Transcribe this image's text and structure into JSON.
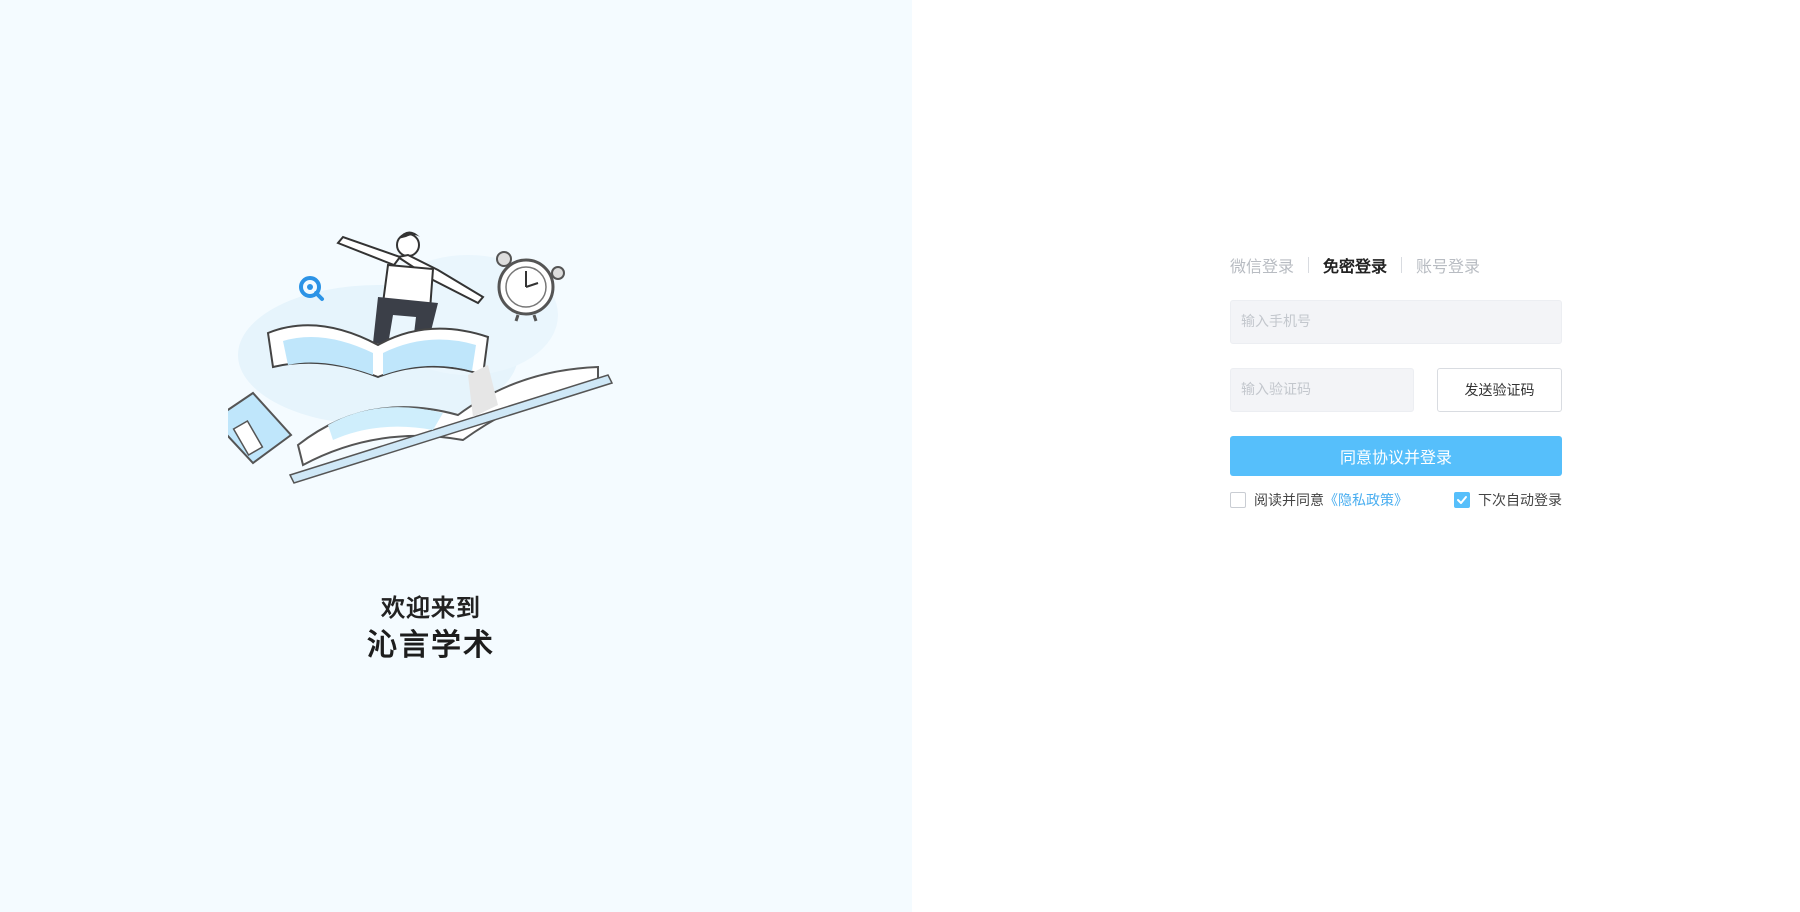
{
  "brand": {
    "welcome": "欢迎来到",
    "name": "沁言学术"
  },
  "tabs": [
    {
      "label": "微信登录",
      "active": false
    },
    {
      "label": "免密登录",
      "active": true
    },
    {
      "label": "账号登录",
      "active": false
    }
  ],
  "form": {
    "phone_placeholder": "输入手机号",
    "code_placeholder": "输入验证码",
    "send_code_label": "发送验证码",
    "submit_label": "同意协议并登录"
  },
  "options": {
    "agree_text": "阅读并同意",
    "privacy_link": "《隐私政策》",
    "agree_checked": false,
    "auto_login_label": "下次自动登录",
    "auto_login_checked": true
  },
  "colors": {
    "accent": "#56bffb",
    "panel_bg": "#f4fbff"
  },
  "icons": [
    "magnifier-icon",
    "alarm-clock-icon",
    "check-icon"
  ]
}
